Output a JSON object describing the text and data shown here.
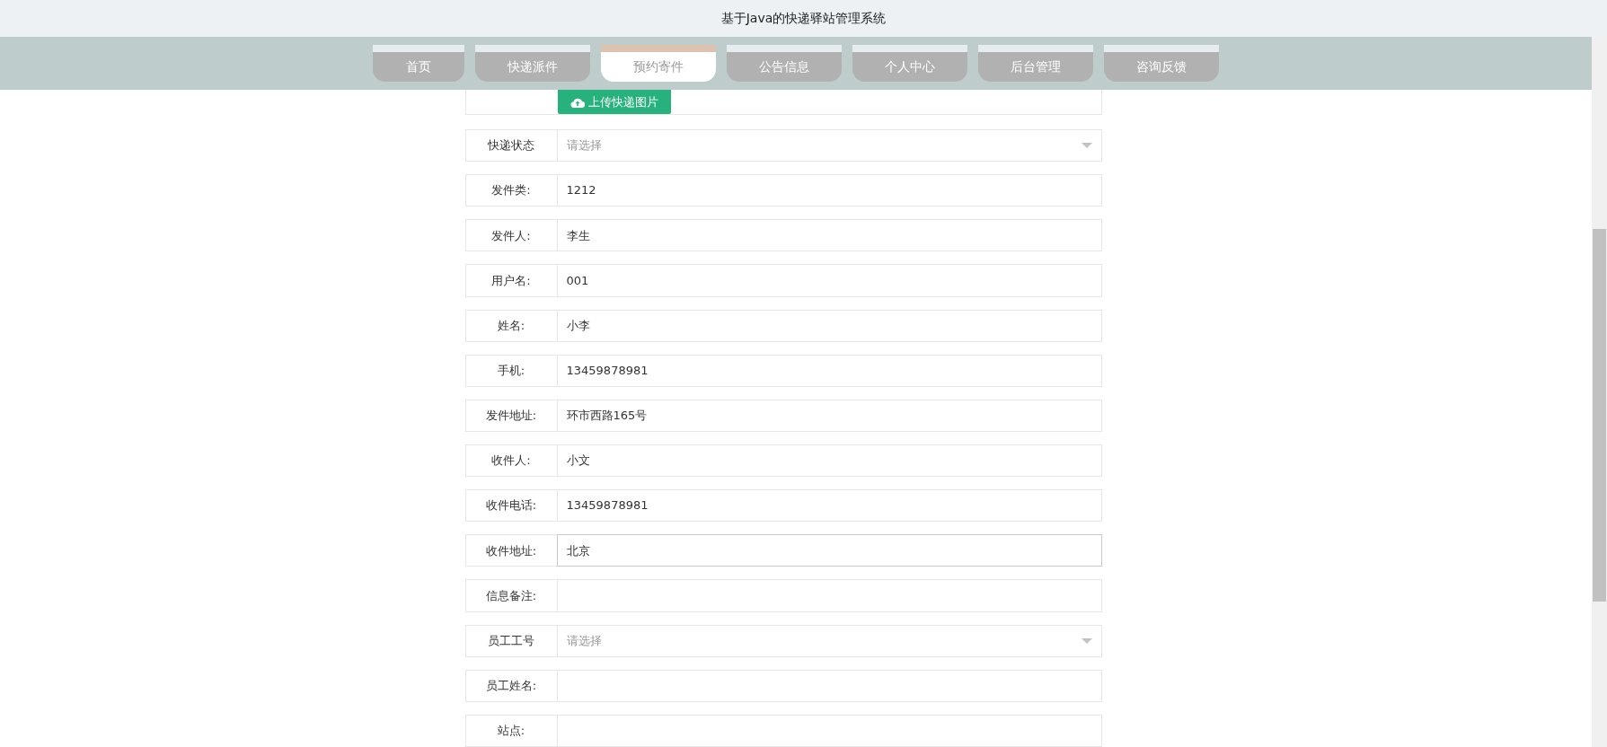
{
  "window": {
    "title": "基于Java的快递驿站管理系统"
  },
  "nav": [
    {
      "label": "首页",
      "selected": false
    },
    {
      "label": "快递派件",
      "selected": false
    },
    {
      "label": "预约寄件",
      "selected": true
    },
    {
      "label": "公告信息",
      "selected": false
    },
    {
      "label": "个人中心",
      "selected": false
    },
    {
      "label": "后台管理",
      "selected": false
    },
    {
      "label": "咨询反馈",
      "selected": false
    }
  ],
  "form": {
    "upload_button": "上传快递图片",
    "rows": [
      {
        "kind": "select",
        "label": "快递状态",
        "placeholder": "请选择"
      },
      {
        "kind": "text",
        "label": "发件类:",
        "value": "1212",
        "focused": false
      },
      {
        "kind": "text",
        "label": "发件人:",
        "value": "李生",
        "focused": false
      },
      {
        "kind": "text",
        "label": "用户名:",
        "value": "001",
        "focused": false
      },
      {
        "kind": "text",
        "label": "姓名:",
        "value": "小李",
        "focused": false
      },
      {
        "kind": "text",
        "label": "手机:",
        "value": "13459878981",
        "focused": false
      },
      {
        "kind": "text",
        "label": "发件地址:",
        "value": "环市西路165号",
        "focused": false
      },
      {
        "kind": "text",
        "label": "收件人:",
        "value": "小文",
        "focused": false
      },
      {
        "kind": "text",
        "label": "收件电话:",
        "value": "13459878981",
        "focused": false
      },
      {
        "kind": "text",
        "label": "收件地址:",
        "value": "北京",
        "focused": true
      },
      {
        "kind": "text",
        "label": "信息备注:",
        "value": "",
        "focused": false
      },
      {
        "kind": "select",
        "label": "员工工号",
        "placeholder": "请选择"
      },
      {
        "kind": "text",
        "label": "员工姓名:",
        "value": "",
        "focused": false
      },
      {
        "kind": "text",
        "label": "站点:",
        "value": "",
        "focused": false
      }
    ]
  }
}
